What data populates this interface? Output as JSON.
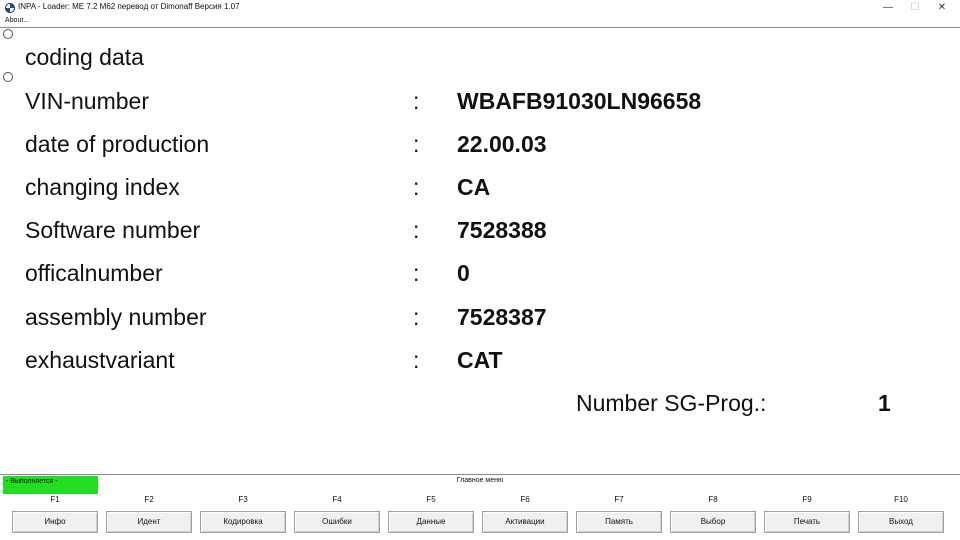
{
  "window": {
    "title": "INPA - Loader:  ME 7.2 M62 перевод от Dimonaff Версия 1.07",
    "icon": "bmw-logo-icon",
    "controls": {
      "minimize": "—",
      "maximize": "☐",
      "close": "✕"
    }
  },
  "menu": {
    "about": "About..."
  },
  "main": {
    "heading": "coding data",
    "colon": ":",
    "rows": [
      {
        "label": "VIN-number",
        "value": "WBAFB91030LN96658"
      },
      {
        "label": "date of production",
        "value": "22.00.03"
      },
      {
        "label": "changing index",
        "value": "CA"
      },
      {
        "label": "Software number",
        "value": "7528388"
      },
      {
        "label": "officalnumber",
        "value": "0"
      },
      {
        "label": "assembly number",
        "value": "7528387"
      },
      {
        "label": "exhaustvariant",
        "value": "CAT"
      }
    ],
    "sg_prog": {
      "label": "Number SG-Prog.:",
      "value": "1"
    }
  },
  "status": {
    "running": "- Выполняется -",
    "running_color": "#22dd22",
    "menu_title": "Главное меню"
  },
  "fkeys": [
    {
      "key": "F1",
      "label": "Инфо"
    },
    {
      "key": "F2",
      "label": "Идент"
    },
    {
      "key": "F3",
      "label": "Кодировка"
    },
    {
      "key": "F4",
      "label": "Ошибки"
    },
    {
      "key": "F5",
      "label": "Данные"
    },
    {
      "key": "F6",
      "label": "Активации"
    },
    {
      "key": "F7",
      "label": "Память"
    },
    {
      "key": "F8",
      "label": "Выбор"
    },
    {
      "key": "F9",
      "label": "Печать"
    },
    {
      "key": "F10",
      "label": "Выход"
    }
  ]
}
